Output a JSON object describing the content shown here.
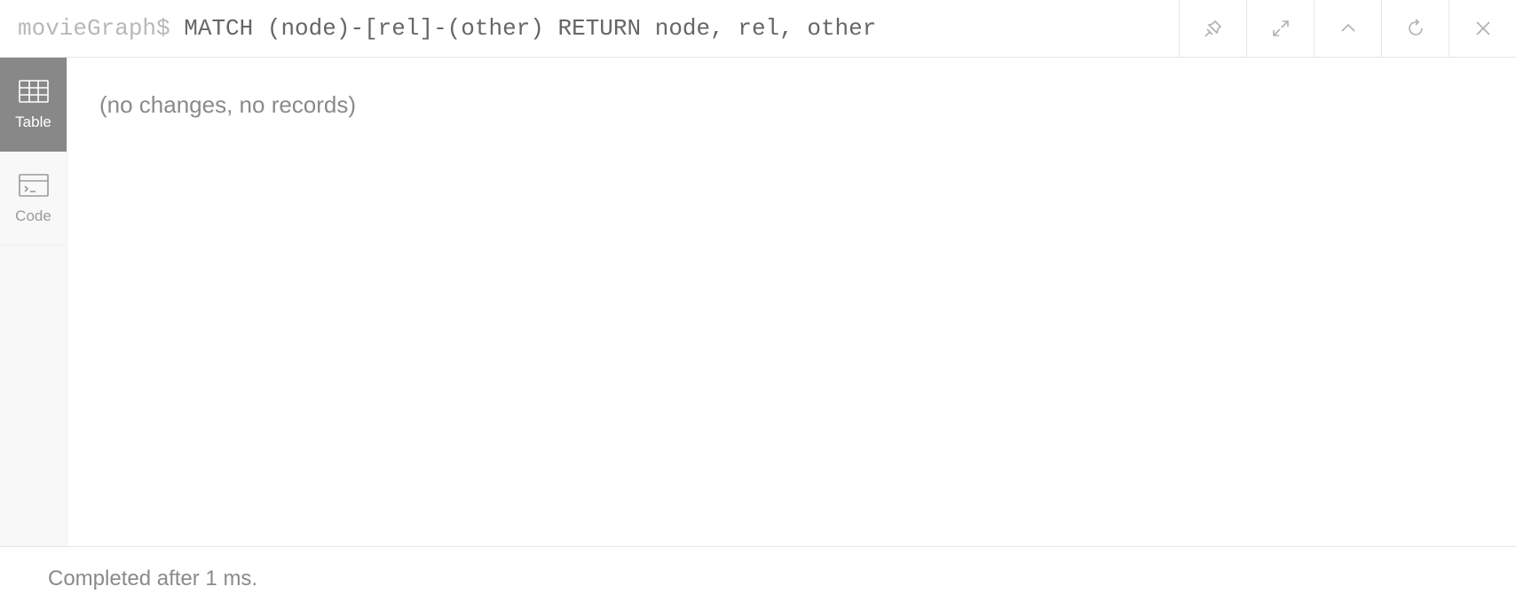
{
  "header": {
    "prompt": "movieGraph$ ",
    "query": "MATCH (node)-[rel]-(other) RETURN node, rel, other"
  },
  "sidebar": {
    "tabs": [
      {
        "label": "Table"
      },
      {
        "label": "Code"
      }
    ]
  },
  "main": {
    "message": "(no changes, no records)"
  },
  "footer": {
    "status": "Completed after 1 ms."
  }
}
